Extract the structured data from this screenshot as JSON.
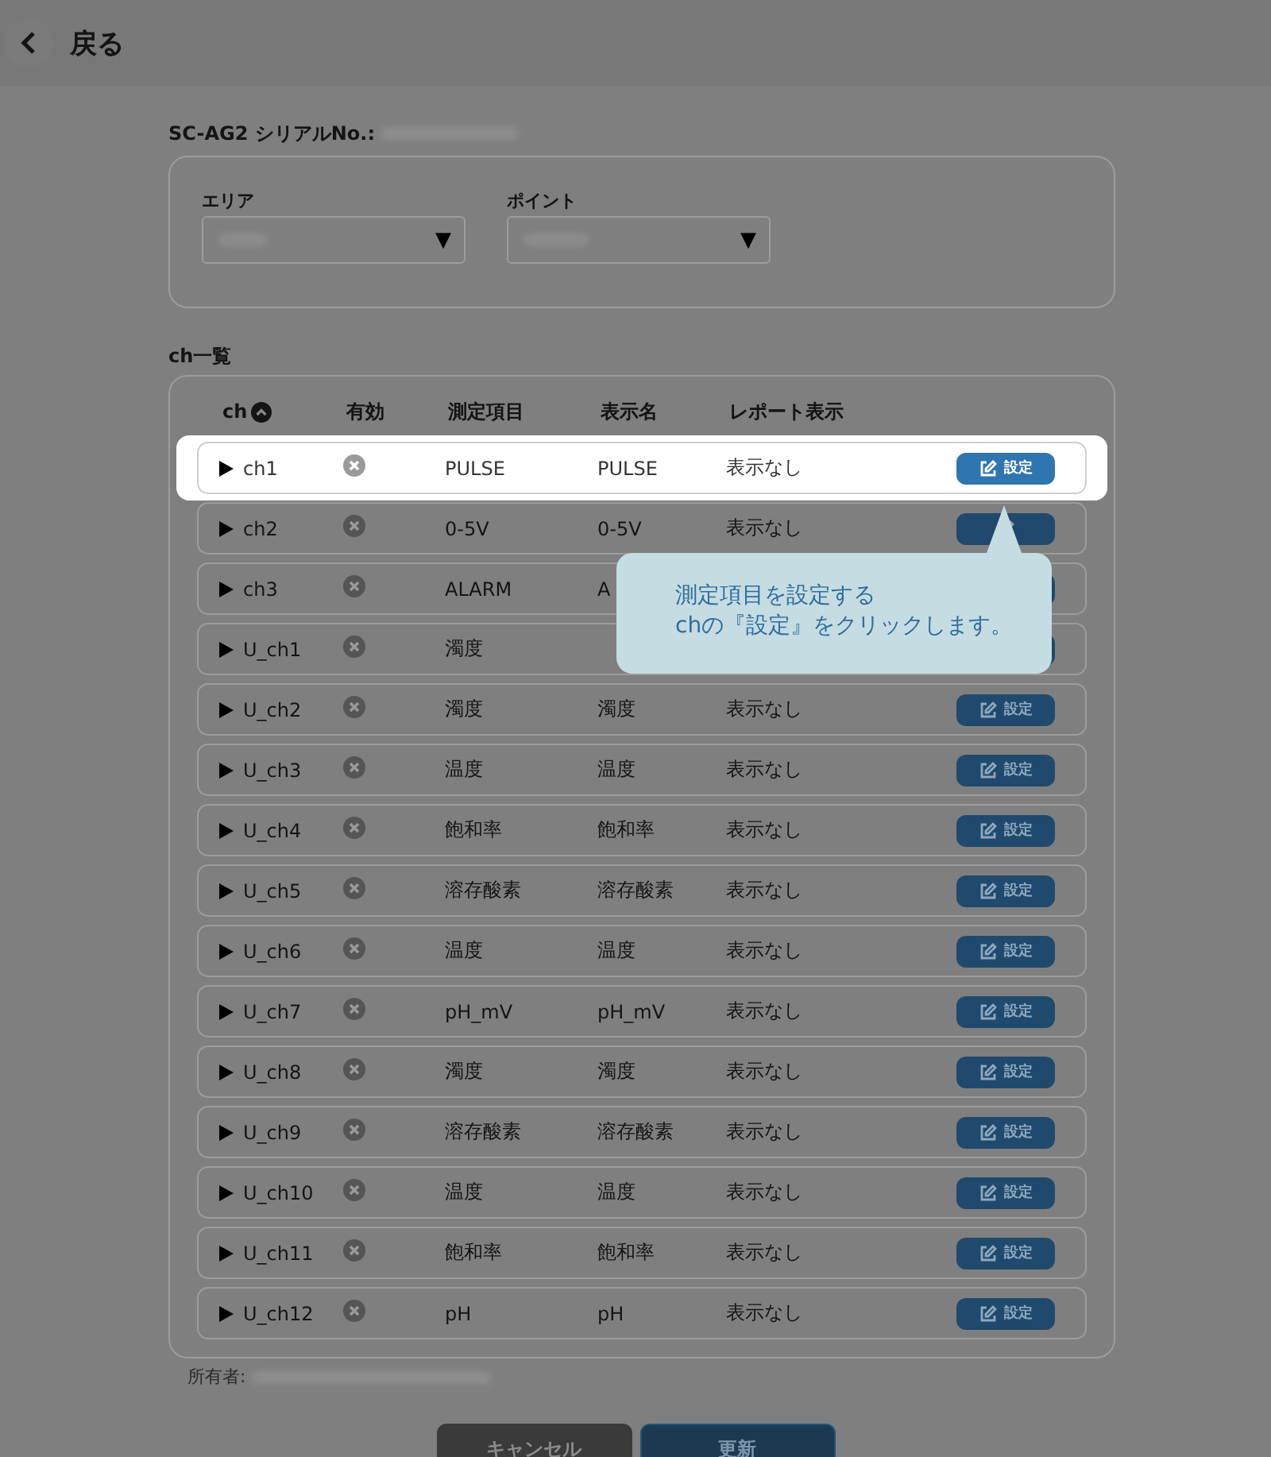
{
  "header": {
    "back_label": "戻る"
  },
  "device": {
    "serial_label": "SC-AG2 シリアルNo.:"
  },
  "selectors": [
    {
      "label": "エリア",
      "arrow": "▼"
    },
    {
      "label": "ポイント",
      "arrow": "▼"
    }
  ],
  "ch_list": {
    "title": "ch一覧",
    "columns": [
      "ch",
      "有効",
      "測定項目",
      "表示名",
      "レポート表示"
    ],
    "rows": [
      {
        "ch": "ch1",
        "enabled": false,
        "item": "PULSE",
        "display": "PULSE",
        "report": "表示なし",
        "button": "設定",
        "highlighted": true
      },
      {
        "ch": "ch2",
        "enabled": false,
        "item": "0-5V",
        "display": "0-5V",
        "report": "表示なし",
        "highlighted": false
      },
      {
        "ch": "ch3",
        "enabled": false,
        "item": "ALARM",
        "display": "A",
        "highlighted": false
      },
      {
        "ch": "U_ch1",
        "enabled": false,
        "item": "濁度",
        "highlighted": false
      },
      {
        "ch": "U_ch2",
        "enabled": false,
        "item": "濁度",
        "display": "濁度",
        "report": "表示なし",
        "button": "設定",
        "highlighted": false
      },
      {
        "ch": "U_ch3",
        "enabled": false,
        "item": "温度",
        "display": "温度",
        "report": "表示なし",
        "button": "設定",
        "highlighted": false
      },
      {
        "ch": "U_ch4",
        "enabled": false,
        "item": "飽和率",
        "display": "飽和率",
        "report": "表示なし",
        "button": "設定",
        "highlighted": false
      },
      {
        "ch": "U_ch5",
        "enabled": false,
        "item": "溶存酸素",
        "display": "溶存酸素",
        "report": "表示なし",
        "button": "設定",
        "highlighted": false
      },
      {
        "ch": "U_ch6",
        "enabled": false,
        "item": "温度",
        "display": "温度",
        "report": "表示なし",
        "button": "設定",
        "highlighted": false
      },
      {
        "ch": "U_ch7",
        "enabled": false,
        "item": "pH_mV",
        "display": "pH_mV",
        "report": "表示なし",
        "button": "設定",
        "highlighted": false
      },
      {
        "ch": "U_ch8",
        "enabled": false,
        "item": "濁度",
        "display": "濁度",
        "report": "表示なし",
        "button": "設定",
        "highlighted": false
      },
      {
        "ch": "U_ch9",
        "enabled": false,
        "item": "溶存酸素",
        "display": "溶存酸素",
        "report": "表示なし",
        "button": "設定",
        "highlighted": false
      },
      {
        "ch": "U_ch10",
        "enabled": false,
        "item": "温度",
        "display": "温度",
        "report": "表示なし",
        "button": "設定",
        "highlighted": false
      },
      {
        "ch": "U_ch11",
        "enabled": false,
        "item": "飽和率",
        "display": "飽和率",
        "report": "表示なし",
        "button": "設定",
        "highlighted": false
      },
      {
        "ch": "U_ch12",
        "enabled": false,
        "item": "pH",
        "display": "pH",
        "report": "表示なし",
        "button": "設定",
        "highlighted": false
      }
    ]
  },
  "owner_label": "所有者:",
  "tooltip": {
    "lines": [
      "測定項目を設定する",
      "chの『設定』をクリックします。"
    ]
  },
  "buttons": [
    {
      "label": "キャンセル",
      "kind": "cancel"
    },
    {
      "label": "更新",
      "kind": "primary"
    }
  ]
}
